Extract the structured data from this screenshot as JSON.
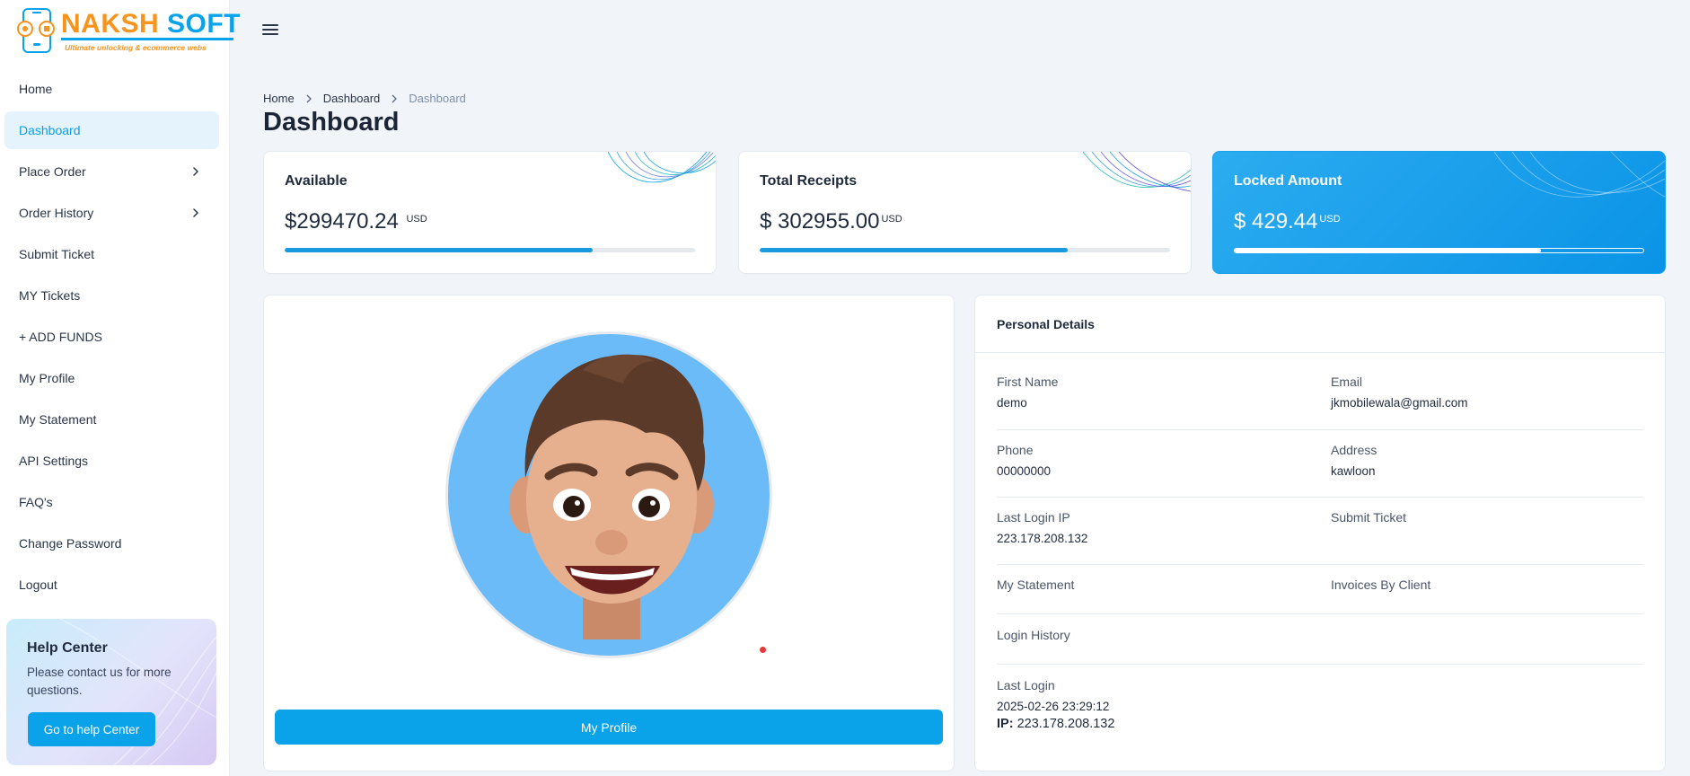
{
  "brand": {
    "part1": "NAKSH",
    "part2": "SOFT",
    "tagline": "Ultimate unlocking & ecommerce webs"
  },
  "sidebar": {
    "items": [
      {
        "label": "Home"
      },
      {
        "label": "Dashboard"
      },
      {
        "label": "Place Order"
      },
      {
        "label": "Order History"
      },
      {
        "label": "Submit Ticket"
      },
      {
        "label": "MY Tickets"
      },
      {
        "label": "+ ADD FUNDS"
      },
      {
        "label": "My Profile"
      },
      {
        "label": "My Statement"
      },
      {
        "label": "API Settings"
      },
      {
        "label": "FAQ's"
      },
      {
        "label": "Change Password"
      },
      {
        "label": "Logout"
      }
    ],
    "active": "Dashboard"
  },
  "help": {
    "title": "Help Center",
    "text": "Please contact us for more questions.",
    "button": "Go to help Center"
  },
  "breadcrumb": [
    "Home",
    "Dashboard",
    "Dashboard"
  ],
  "page_title": "Dashboard",
  "stats": [
    {
      "label": "Available",
      "amount": "$299470.24",
      "currency": "USD",
      "progress": 0.75
    },
    {
      "label": "Total Receipts",
      "amount": "$ 302955.00",
      "currency": "USD",
      "progress": 0.75
    },
    {
      "label": "Locked Amount",
      "amount": "$ 429.44",
      "currency": "USD",
      "progress": 0.75
    }
  ],
  "profile": {
    "button": "My Profile"
  },
  "details": {
    "title": "Personal Details",
    "first_name_label": "First Name",
    "first_name": "demo",
    "email_label": "Email",
    "email": "jkmobilewala@gmail.com",
    "phone_label": "Phone",
    "phone": "00000000",
    "address_label": "Address",
    "address": "kawloon",
    "last_ip_label": "Last Login IP",
    "last_ip": "223.178.208.132",
    "submit_ticket": "Submit Ticket",
    "my_statement": "My Statement",
    "invoices": "Invoices By Client",
    "login_history": "Login History",
    "last_login_label": "Last Login",
    "last_login": "2025-02-26 23:29:12",
    "ip_prefix": "IP:",
    "ip": "223.178.208.132"
  },
  "colors": {
    "accent": "#0aa2e8",
    "brand_orange": "#f7941d",
    "background": "#f1f4f8",
    "status_dot": "#e53935"
  }
}
